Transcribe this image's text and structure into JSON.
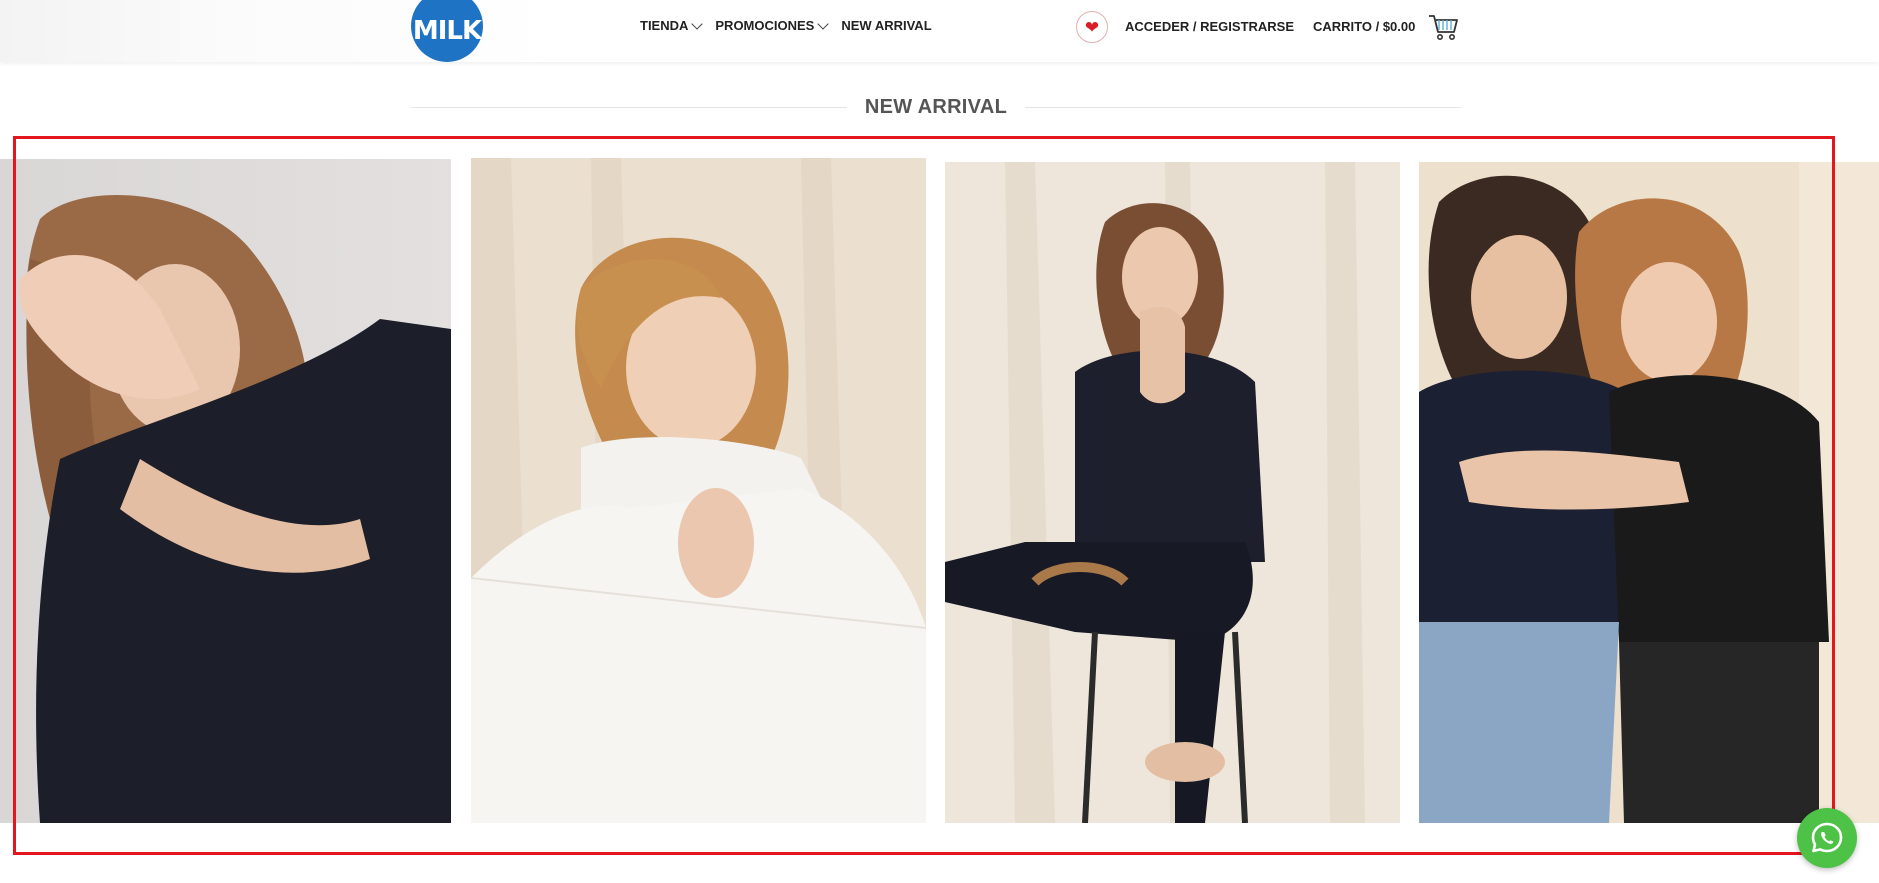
{
  "header": {
    "logo_text": "MILK",
    "nav": [
      {
        "label": "TIENDA",
        "has_dropdown": true
      },
      {
        "label": "PROMOCIONES",
        "has_dropdown": true
      },
      {
        "label": "NEW ARRIVAL",
        "has_dropdown": false
      }
    ],
    "wishlist_icon": "heart-icon",
    "account_label": "ACCEDER / REGISTRARSE",
    "cart_label": "CARRITO / $0.00",
    "cart_icon": "shopping-cart-icon"
  },
  "section": {
    "title": "NEW ARRIVAL"
  },
  "gallery": {
    "items": [
      {
        "name": "woman in black sweater covering face"
      },
      {
        "name": "woman in white turtleneck sweater laughing"
      },
      {
        "name": "woman in black outfit sitting on stool"
      },
      {
        "name": "two women hugging in black tops and jeans"
      }
    ]
  },
  "whatsapp": {
    "icon": "whatsapp-icon"
  },
  "colors": {
    "brand_blue": "#1f73c4",
    "heart_red": "#d91e2a",
    "highlight_red": "#e3161e",
    "whatsapp_green": "#4dc247"
  }
}
